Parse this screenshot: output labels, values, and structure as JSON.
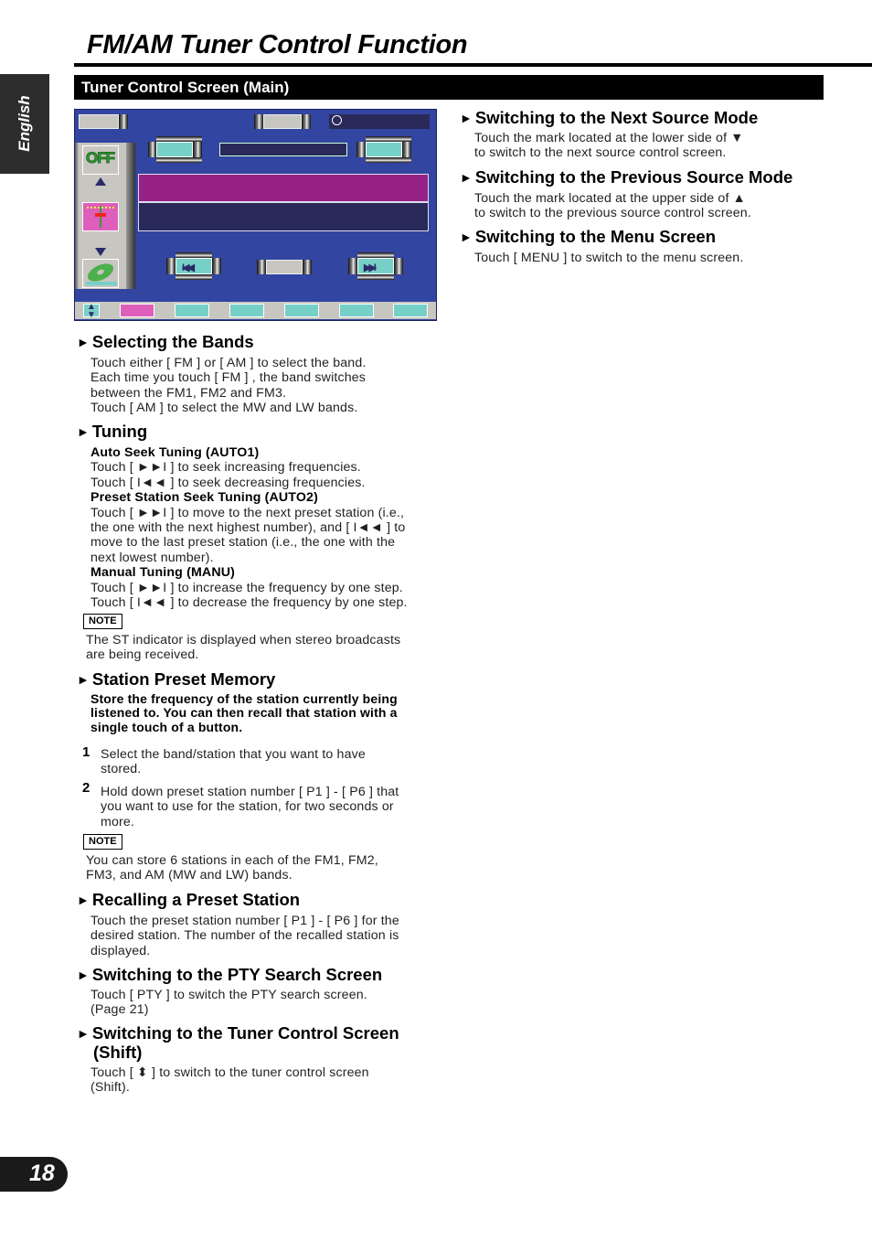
{
  "page": {
    "title": "FM/AM Tuner Control Function",
    "language_tab": "English",
    "section_bar": "Tuner Control Screen (Main)",
    "page_number": "18"
  },
  "screen": {
    "off_icon_label": "OFF",
    "icons": [
      "clock-icon",
      "off-icon",
      "tuner-antenna-icon",
      "disc-icon",
      "shift-icon",
      "seek-back-icon",
      "seek-forward-icon",
      "up-arrow-icon",
      "down-arrow-icon"
    ],
    "preset_count": 6,
    "colors": {
      "background": "#3245a0",
      "teal": "#77d0c8",
      "magenta": "#962285",
      "pink": "#dd5fbb",
      "navy": "#2a2a5a",
      "gray": "#c8c6c0"
    }
  },
  "right": [
    {
      "heading": "Switching to the Next Source Mode",
      "lines": [
        "Touch the mark located at the lower side of ▼",
        "to switch to the next source control screen."
      ]
    },
    {
      "heading": "Switching to the Previous Source Mode",
      "lines": [
        "Touch the mark located at the upper side of ▲",
        "to switch to the previous source control screen."
      ]
    },
    {
      "heading": "Switching to the Menu Screen",
      "lines": [
        "Touch [ MENU ] to switch to the menu screen."
      ]
    }
  ],
  "bands": {
    "heading": "Selecting the Bands",
    "lines": [
      "Touch either [ FM ] or [ AM ] to select the band.",
      "Each time you touch [ FM ] , the band switches",
      "between the FM1, FM2 and FM3.",
      "Touch [ AM ] to select the MW and LW bands."
    ]
  },
  "tuning": {
    "heading": "Tuning",
    "auto1_title": "Auto Seek Tuning (AUTO1)",
    "auto1_lines": [
      "Touch [ ►►I ] to seek increasing frequencies.",
      "Touch [ I◄◄ ] to seek decreasing frequencies."
    ],
    "auto2_title": "Preset Station Seek Tuning (AUTO2)",
    "auto2_lines": [
      "Touch [ ►►I ] to move to the next preset station (i.e.,",
      "the one with the next highest number), and [ I◄◄ ] to",
      "move to the last preset station (i.e., the one with the",
      "next lowest number)."
    ],
    "manu_title": "Manual Tuning (MANU)",
    "manu_lines": [
      "Touch [ ►►I ] to increase the frequency by one step.",
      "Touch [ I◄◄ ] to decrease the frequency by one step."
    ],
    "note_label": "NOTE",
    "note_lines": [
      "The ST indicator is displayed when stereo broadcasts",
      "are being received."
    ]
  },
  "preset_memory": {
    "heading": "Station Preset Memory",
    "intro": [
      "Store the frequency of the station currently being",
      "listened to. You can then recall that station with a",
      "single touch of a button."
    ],
    "steps": [
      {
        "num": "1",
        "lines": [
          "Select the band/station that you want to have",
          "stored."
        ]
      },
      {
        "num": "2",
        "lines": [
          "Hold down preset station number [ P1 ] - [ P6 ] that",
          "you want to use for the station, for two seconds or",
          "more."
        ]
      }
    ],
    "note_label": "NOTE",
    "note_lines": [
      "You can store 6 stations in each of the FM1, FM2,",
      "FM3, and AM (MW and LW) bands."
    ]
  },
  "recall": {
    "heading": "Recalling a Preset Station",
    "lines": [
      "Touch the preset station number [ P1 ] - [ P6 ] for the",
      "desired station. The number of the recalled station is",
      "displayed."
    ]
  },
  "pty": {
    "heading": "Switching to the PTY Search Screen",
    "lines": [
      "Touch [ PTY ] to switch the PTY search screen.",
      "(Page 21)"
    ]
  },
  "shift": {
    "heading_line1": "Switching to the Tuner Control Screen",
    "heading_line2": "(Shift)",
    "lines": [
      "Touch [ ⬍ ] to switch to the tuner control screen",
      "(Shift)."
    ]
  }
}
